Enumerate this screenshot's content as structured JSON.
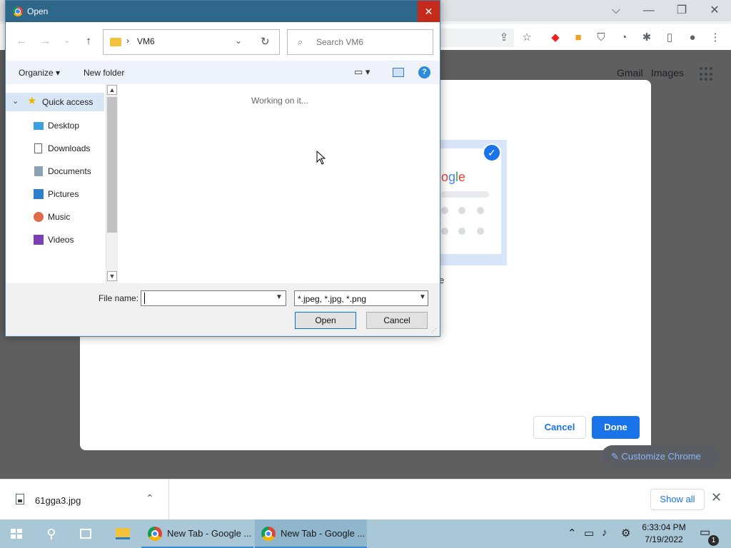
{
  "browser": {
    "header_links": [
      "Gmail",
      "Images"
    ],
    "customize_chrome_label": "Customize Chrome"
  },
  "customize_dialog": {
    "cancel_label": "Cancel",
    "done_label": "Done",
    "preview_logo_text": "ogle",
    "caption_fragment": "e"
  },
  "open_dialog": {
    "title": "Open",
    "address_folder": "VM6",
    "search_placeholder": "Search VM6",
    "organize_label": "Organize ▾",
    "new_folder_label": "New folder",
    "nav_items": [
      {
        "label": "Quick access",
        "icon": "star-icon"
      },
      {
        "label": "Desktop",
        "icon": "desktop-icon"
      },
      {
        "label": "Downloads",
        "icon": "downloads-icon"
      },
      {
        "label": "Documents",
        "icon": "documents-icon"
      },
      {
        "label": "Pictures",
        "icon": "pictures-icon"
      },
      {
        "label": "Music",
        "icon": "music-icon"
      },
      {
        "label": "Videos",
        "icon": "videos-icon"
      }
    ],
    "status_text": "Working on it...",
    "file_name_label": "File name:",
    "file_name_value": "",
    "file_type_value": "*.jpeg, *.jpg, *.png",
    "open_button": "Open",
    "cancel_button": "Cancel"
  },
  "downloads_bar": {
    "file_name": "61gga3.jpg",
    "show_all_label": "Show all"
  },
  "taskbar": {
    "tasks": [
      {
        "label": "New Tab - Google ..."
      },
      {
        "label": "New Tab - Google ..."
      }
    ],
    "time": "6:33:04 PM",
    "date": "7/19/2022",
    "notification_count": "1"
  },
  "colors": {
    "dialog_title_bar": "#2e6789",
    "close_button": "#c42b1c",
    "accent_blue": "#1a73e8",
    "taskbar": "#aac7d8"
  }
}
